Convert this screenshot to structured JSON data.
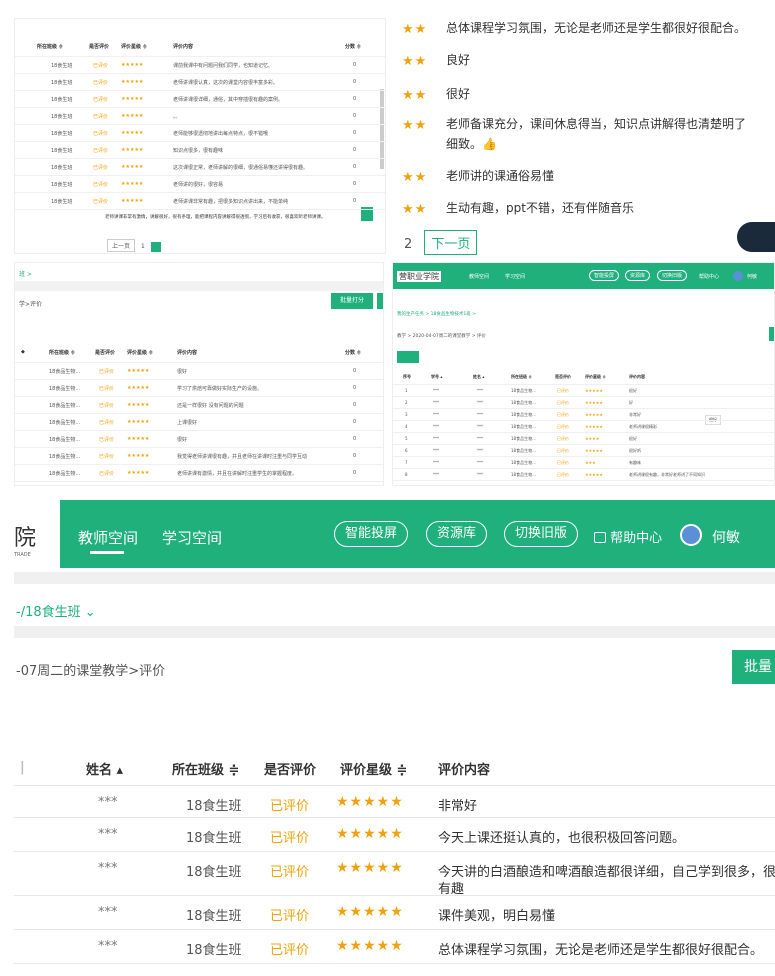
{
  "colors": {
    "brand": "#1fb07c",
    "star": "#f0a20a",
    "evaluated": "#f0a20a"
  },
  "thumb_tl": {
    "headers": [
      "所在班级 ≑",
      "是否评价",
      "评价星级 ≑",
      "评价内容",
      "分数 ≑"
    ],
    "rows": [
      {
        "cls": "18食生班",
        "status": "已评价",
        "stars": "★★★★★",
        "content": "课前我课中有问题问我们同学，也知道记忆。",
        "score": "0"
      },
      {
        "cls": "18食生班",
        "status": "已评价",
        "stars": "★★★★★",
        "content": "老师讲课很认真，这次的课堂内容很丰富多彩。",
        "score": "0"
      },
      {
        "cls": "18食生班",
        "status": "已评价",
        "stars": "★★★★★",
        "content": "老师讲课很详细，通俗，其中穿插很有趣的案例。",
        "score": "0"
      },
      {
        "cls": "18食生班",
        "status": "已评价",
        "stars": "★★★★★",
        "content": "。。",
        "score": "0"
      },
      {
        "cls": "18食生班",
        "status": "已评价",
        "stars": "★★★★★",
        "content": "老师能够很透彻地讲出每点特点，很不错哦",
        "score": "0"
      },
      {
        "cls": "18食生班",
        "status": "已评价",
        "stars": "★★★★★",
        "content": "知识点很多，很有趣味",
        "score": "0"
      },
      {
        "cls": "18食生班",
        "status": "已评价",
        "stars": "★★★★★",
        "content": "这次课很正常，老师讲解的很细，很通俗易懂还讲得很有趣。",
        "score": "0"
      },
      {
        "cls": "18食生班",
        "status": "已评价",
        "stars": "★★★★★",
        "content": "老师讲的很好，很容易",
        "score": "0"
      },
      {
        "cls": "18食生班",
        "status": "已评价",
        "stars": "★★★★★",
        "content": "老师讲课非常有趣，把很多知识点讲出来，不能单纯",
        "score": "0"
      }
    ],
    "note": "老师讲课非常有激情，讲解很好，很有条理，能把课程内容讲解得很透彻，学习后有收获，很喜欢听老师讲课。",
    "prev": "上一页",
    "page": "1"
  },
  "thumb_tr": {
    "rows": [
      {
        "stars": "★★",
        "content": "总体课程学习氛围，无论是老师还是学生都很好很配合。"
      },
      {
        "stars": "★★",
        "content": "良好"
      },
      {
        "stars": "★★",
        "content": "很好"
      },
      {
        "stars": "★★",
        "content": "老师备课充分，课间休息得当，知识点讲解得也清楚明了细致。👍"
      },
      {
        "stars": "★★",
        "content": "老师讲的课通俗易懂"
      },
      {
        "stars": "★★",
        "content": "生动有趣，ppt不错，还有伴随音乐"
      }
    ],
    "page": "2",
    "next": "下一页"
  },
  "thumb_ml": {
    "crumb1": "班 >",
    "crumb2": "学>评价",
    "batch_btn": "批量打分",
    "headers": [
      "所在班级 ≑",
      "是否评价",
      "评价星级 ≑",
      "评价内容",
      "分数 ≑"
    ],
    "rows": [
      {
        "cls": "18食品生物...",
        "status": "已评价",
        "stars": "★★★★★",
        "content": "很好",
        "score": "0"
      },
      {
        "cls": "18食品生物...",
        "status": "已评价",
        "stars": "★★★★★",
        "content": "学习了烘焙可靠做好实际生产的设施。",
        "score": "0"
      },
      {
        "cls": "18食品生物...",
        "status": "已评价",
        "stars": "★★★★★",
        "content": "还是一样很好 没有问题的问题",
        "score": "0"
      },
      {
        "cls": "18食品生物...",
        "status": "已评价",
        "stars": "★★★★★",
        "content": "上课很好",
        "score": "0"
      },
      {
        "cls": "18食品生物...",
        "status": "已评价",
        "stars": "★★★★★",
        "content": "很好",
        "score": "0"
      },
      {
        "cls": "18食品生物...",
        "status": "已评价",
        "stars": "★★★★★",
        "content": "我觉得老师讲课很有趣，并且老师在讲课时注重与同学互动",
        "score": "0"
      },
      {
        "cls": "18食品生物...",
        "status": "已评价",
        "stars": "★★★★★",
        "content": "老师讲课有激情，并且在讲解时注重学生的掌握程度。",
        "score": "0"
      }
    ]
  },
  "thumb_mr": {
    "brand": "营职业学院",
    "nav": [
      "教师空间",
      "学习空间"
    ],
    "pills": [
      "智能投屏",
      "资源库",
      "切换旧版"
    ],
    "help": "帮助中心",
    "user": "何敏",
    "crumb": "我的生产任务 > 18食品生物技术1班 >",
    "crumb2": "教学 > 2020-04-07周二的课堂教学 > 评价",
    "headers": [
      "序号",
      "学号 ▴",
      "姓名 ▴",
      "所在班级 ≑",
      "是否评价",
      "评价星级 ≑",
      "评价内容"
    ],
    "rows": [
      {
        "n": "1",
        "sid": "***",
        "name": "***",
        "cls": "18食品生物...",
        "status": "已评价",
        "stars": "★★★★★",
        "content": "很好"
      },
      {
        "n": "2",
        "sid": "***",
        "name": "***",
        "cls": "18食品生物...",
        "status": "已评价",
        "stars": "★★★★★",
        "content": "好"
      },
      {
        "n": "3",
        "sid": "***",
        "name": "***",
        "cls": "18食品生物...",
        "status": "已评价",
        "stars": "★★★★★",
        "content": "非常好"
      },
      {
        "n": "4",
        "sid": "***",
        "name": "***",
        "cls": "18食品生物...",
        "status": "已评价",
        "stars": "★★★★★",
        "content": "老师讲课很精彩"
      },
      {
        "n": "5",
        "sid": "***",
        "name": "***",
        "cls": "18食品生物...",
        "status": "已评价",
        "stars": "★★★★",
        "content": "很好"
      },
      {
        "n": "6",
        "sid": "***",
        "name": "***",
        "cls": "18食品生物...",
        "status": "已评价",
        "stars": "★★★★★",
        "content": "很好听"
      },
      {
        "n": "7",
        "sid": "***",
        "name": "***",
        "cls": "18食品生物...",
        "status": "已评价",
        "stars": "★★★",
        "content": "有趣味"
      },
      {
        "n": "8",
        "sid": "***",
        "name": "***",
        "cls": "18食品生物...",
        "status": "已评价",
        "stars": "★★★★★",
        "content": "老师讲课很有趣，非常好老师讲了不同知识"
      }
    ],
    "tooltip": "很好"
  },
  "main": {
    "brand_char": "院",
    "brand_sub": "TRADE",
    "nav": [
      "教师空间",
      "学习空间"
    ],
    "pills": [
      "智能投屏",
      "资源库",
      "切换旧版"
    ],
    "help": "帮助中心",
    "user": "何敏",
    "class_crumb": "-/18食生班 ⌄",
    "breadcrumb": "-07周二的课堂教学>评价",
    "batch_btn": "批量",
    "headers": {
      "name": "姓名 ▴",
      "cls": "所在班级 ≑",
      "status": "是否评价",
      "stars": "评价星级 ≑",
      "content": "评价内容"
    },
    "rows": [
      {
        "name": "***",
        "cls": "18食生班",
        "status": "已评价",
        "stars": "★★★★★",
        "content": "非常好"
      },
      {
        "name": "***",
        "cls": "18食生班",
        "status": "已评价",
        "stars": "★★★★★",
        "content": "今天上课还挺认真的，也很积极回答问题。"
      },
      {
        "name": "***",
        "cls": "18食生班",
        "status": "已评价",
        "stars": "★★★★★",
        "content": "今天讲的白酒酿造和啤酒酿造都很详细，自己学到很多，很",
        "content2": "有趣"
      },
      {
        "name": "***",
        "cls": "18食生班",
        "status": "已评价",
        "stars": "★★★★★",
        "content": "课件美观，明白易懂"
      },
      {
        "name": "***",
        "cls": "18食生班",
        "status": "已评价",
        "stars": "★★★★★",
        "content": "总体课程学习氛围，无论是老师还是学生都很好很配合。"
      }
    ]
  }
}
